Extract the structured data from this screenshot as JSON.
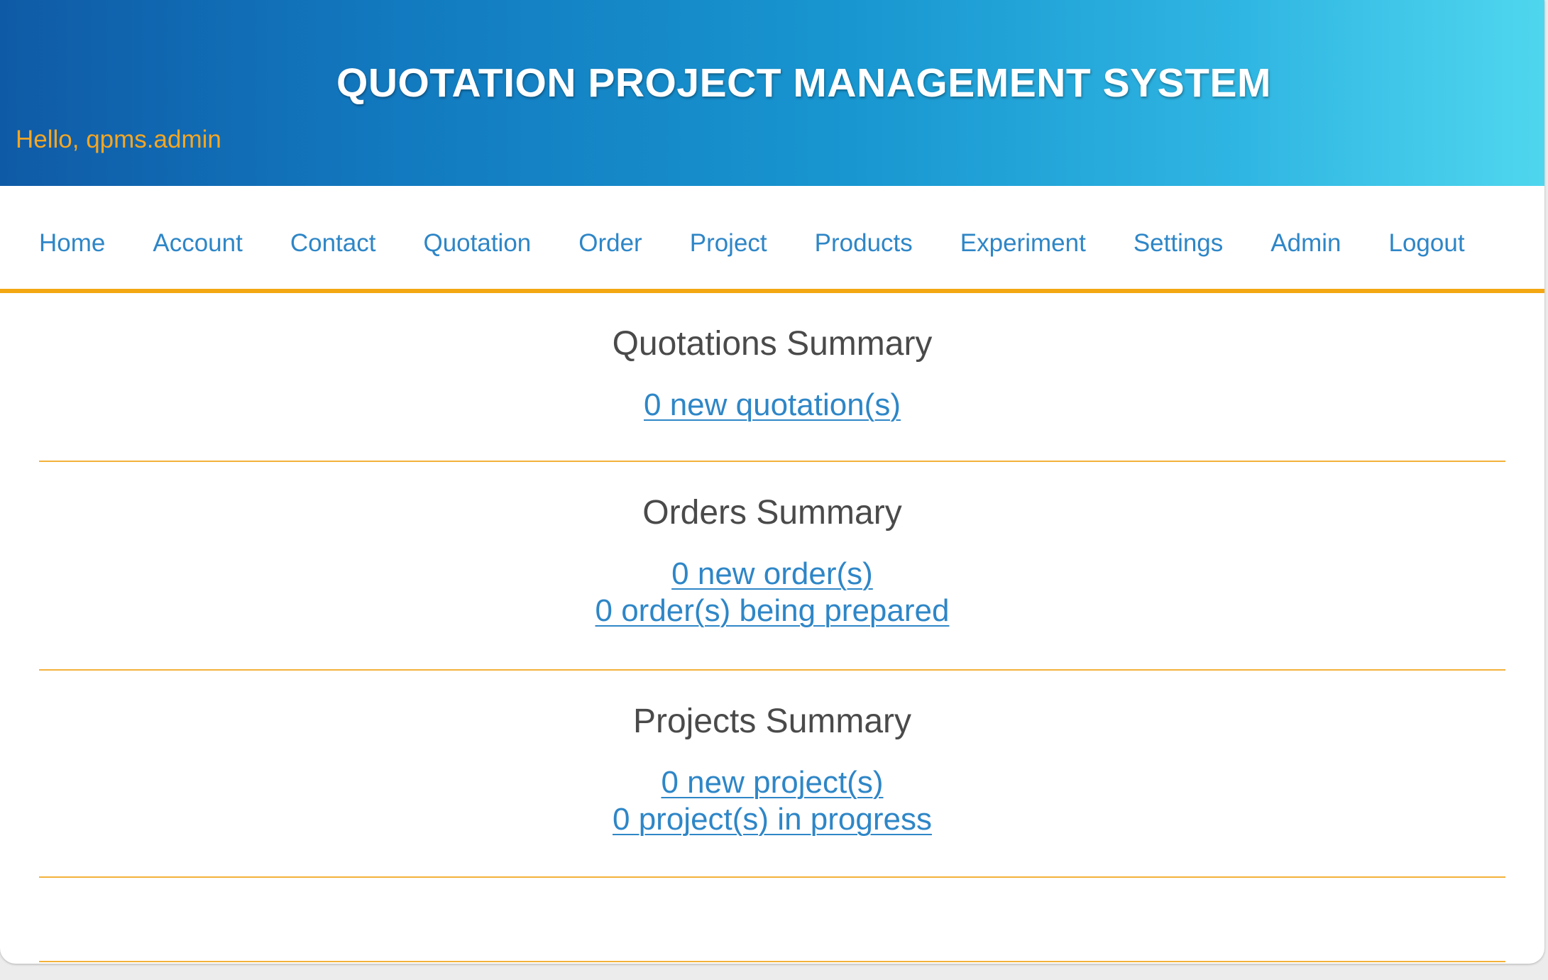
{
  "header": {
    "title": "QUOTATION PROJECT MANAGEMENT SYSTEM",
    "greeting": "Hello, qpms.admin"
  },
  "nav": {
    "items": [
      {
        "label": "Home"
      },
      {
        "label": "Account"
      },
      {
        "label": "Contact"
      },
      {
        "label": "Quotation"
      },
      {
        "label": "Order"
      },
      {
        "label": "Project"
      },
      {
        "label": "Products"
      },
      {
        "label": "Experiment"
      },
      {
        "label": "Settings"
      },
      {
        "label": "Admin"
      },
      {
        "label": "Logout"
      }
    ]
  },
  "quotations": {
    "title": "Quotations Summary",
    "links": [
      {
        "label": "0 new quotation(s)"
      }
    ]
  },
  "orders": {
    "title": "Orders Summary",
    "links": [
      {
        "label": "0 new order(s)"
      },
      {
        "label": "0 order(s) being prepared"
      }
    ]
  },
  "projects": {
    "title": "Projects Summary",
    "links": [
      {
        "label": "0 new project(s)"
      },
      {
        "label": "0 project(s) in progress"
      }
    ]
  },
  "colors": {
    "header_gradient_start": "#0f5aa6",
    "header_gradient_end": "#4fd6ee",
    "accent_orange": "#f3a712",
    "greeting_text": "#f5a623",
    "link_blue": "#2e86c7",
    "heading_gray": "#4a4a4a"
  }
}
